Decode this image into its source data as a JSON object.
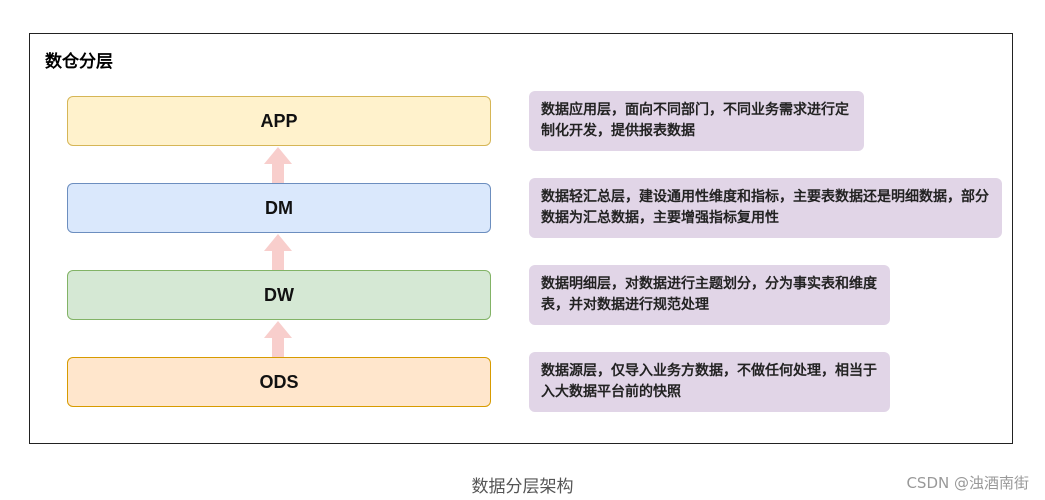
{
  "title": "数仓分层",
  "layers": [
    {
      "label": "APP",
      "note": "数据应用层，面向不同部门，不同业务需求进行定制化开发，提供报表数据",
      "fill": "#fff2cc",
      "stroke": "#d6b656"
    },
    {
      "label": "DM",
      "note": "数据轻汇总层，建设通用性维度和指标，主要表数据还是明细数据，部分数据为汇总数据，主要增强指标复用性",
      "fill": "#dae8fc",
      "stroke": "#6c8ebf"
    },
    {
      "label": "DW",
      "note": "数据明细层，对数据进行主题划分，分为事实表和维度表，并对数据进行规范处理",
      "fill": "#d5e8d4",
      "stroke": "#82b366"
    },
    {
      "label": "ODS",
      "note": "数据源层，仅导入业务方数据，不做任何处理，相当于入大数据平台前的快照",
      "fill": "#ffe6cc",
      "stroke": "#d79b00"
    }
  ],
  "colors": {
    "note_fill": "#e1d5e7",
    "arrow_fill": "#f8cecc"
  },
  "caption": "数据分层架构",
  "watermark": "CSDN @浊酒南街"
}
